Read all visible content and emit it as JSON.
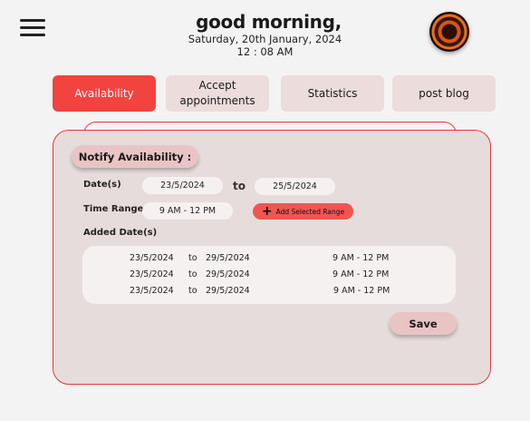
{
  "header": {
    "greeting": "good morning,",
    "date": "Saturday, 20th January, 2024",
    "time": "12 : 08 AM"
  },
  "tabs": [
    {
      "label": "Availability",
      "active": true
    },
    {
      "label": "Accept appointments",
      "active": false
    },
    {
      "label": "Statistics",
      "active": false
    },
    {
      "label": "post blog",
      "active": false
    }
  ],
  "form": {
    "title": "Notify Availability :",
    "dates_label": "Date(s)",
    "date_from": "23/5/2024",
    "date_to_word": "to",
    "date_to": "25/5/2024",
    "time_range_label": "Time Range",
    "time_range_value": "9 AM - 12 PM",
    "add_range_label": "Add Selected Range",
    "added_dates_label": "Added Date(s)",
    "added_dates": [
      {
        "from": "23/5/2024",
        "to_word": "to",
        "to": "29/5/2024",
        "time": "9 AM - 12 PM"
      },
      {
        "from": "23/5/2024",
        "to_word": "to",
        "to": "29/5/2024",
        "time": "9 AM - 12 PM"
      },
      {
        "from": "23/5/2024",
        "to_word": "to",
        "to": "29/5/2024",
        "time": "9 AM - 12 PM"
      }
    ],
    "save_label": "Save"
  },
  "colors": {
    "accent": "#f2433f",
    "card_border": "#e33a3a",
    "card_bg": "#e7dcdc",
    "tab_bg": "#ecdcdc"
  },
  "icons": {
    "menu": "hamburger-icon",
    "add": "plus-icon",
    "avatar": "profile-avatar"
  }
}
